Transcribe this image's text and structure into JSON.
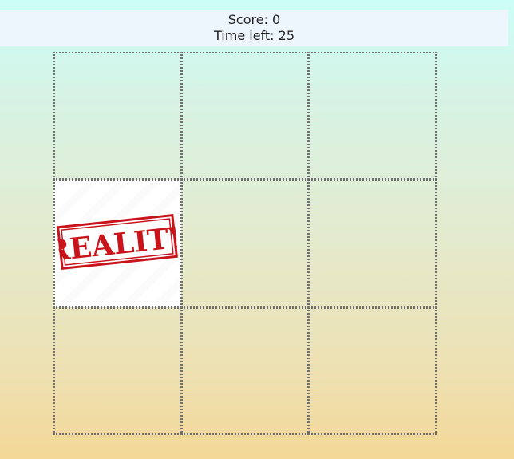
{
  "scoreboard": {
    "score_text": "Score: 0",
    "time_text": "Time left: 25"
  },
  "grid": {
    "cells": [
      {
        "row": 1,
        "col": 1,
        "content": ""
      },
      {
        "row": 1,
        "col": 2,
        "content": ""
      },
      {
        "row": 1,
        "col": 3,
        "content": ""
      },
      {
        "row": 2,
        "col": 1,
        "content": "reality-stamp"
      },
      {
        "row": 2,
        "col": 2,
        "content": ""
      },
      {
        "row": 2,
        "col": 3,
        "content": ""
      },
      {
        "row": 3,
        "col": 1,
        "content": ""
      },
      {
        "row": 3,
        "col": 2,
        "content": ""
      },
      {
        "row": 3,
        "col": 3,
        "content": ""
      }
    ],
    "stamp_text": "REALITY",
    "stamp_color": "#c8141a"
  },
  "colors": {
    "background_top": "#cbfff8",
    "background_bottom": "#f3d897",
    "scoreboard_bg": "#eef6fd",
    "cell_border": "#6f6f6f"
  }
}
